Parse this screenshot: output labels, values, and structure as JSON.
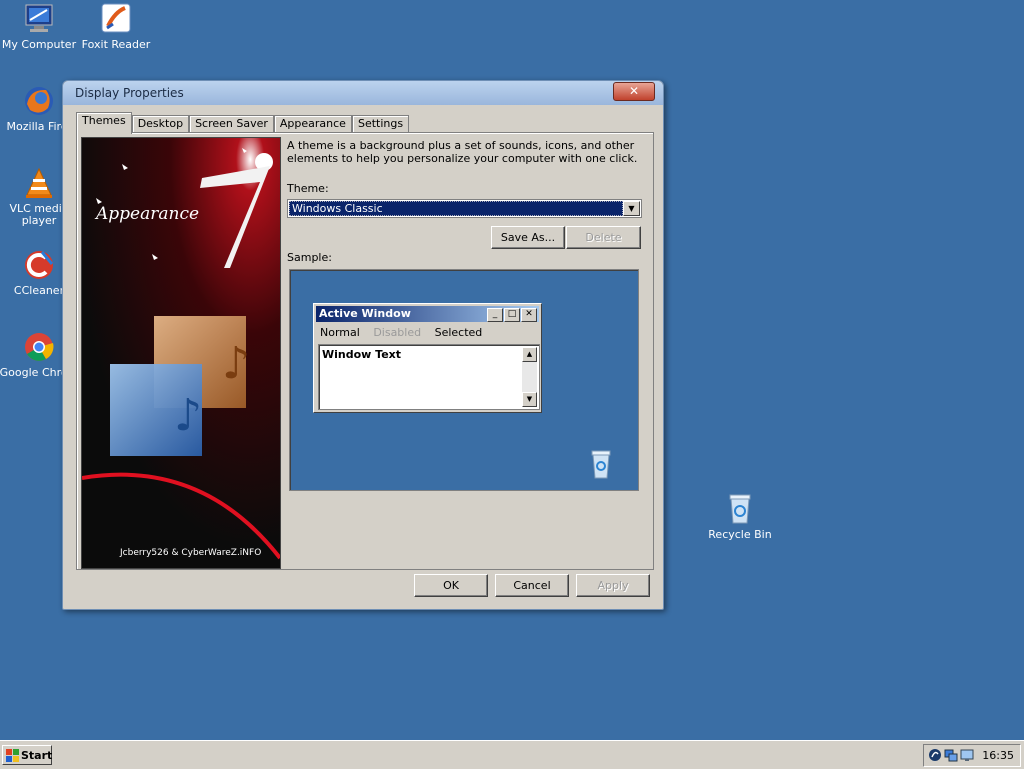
{
  "desktop": {
    "icons": [
      {
        "label": "My Computer",
        "icon": "my-computer-icon"
      },
      {
        "label": "Foxit Reader",
        "icon": "foxit-reader-icon"
      },
      {
        "label": "Mozilla Firef",
        "icon": "firefox-icon"
      },
      {
        "label": "VLC media player",
        "icon": "vlc-icon"
      },
      {
        "label": "CCleaner",
        "icon": "ccleaner-icon"
      },
      {
        "label": "Google Chrom",
        "icon": "chrome-icon"
      },
      {
        "label": "Recycle Bin",
        "icon": "recycle-bin-icon"
      }
    ]
  },
  "window": {
    "title": "Display Properties",
    "close_glyph": "✕",
    "tabs": [
      "Themes",
      "Desktop",
      "Screen Saver",
      "Appearance",
      "Settings"
    ],
    "active_tab": "Themes",
    "banner": {
      "title": "Appearance",
      "big_numeral": "7",
      "credit": "Jcberry526 & CyberWareZ.iNFO"
    },
    "description": "A theme is a background plus a set of sounds, icons, and other elements to help you personalize your computer with one click.",
    "theme_label": "Theme:",
    "theme_value": "Windows Classic",
    "save_as_label": "Save As...",
    "delete_label": "Delete",
    "sample_label": "Sample:",
    "sample": {
      "window_title": "Active Window",
      "menu_normal": "Normal",
      "menu_disabled": "Disabled",
      "menu_selected": "Selected",
      "window_text": "Window Text"
    },
    "ok_label": "OK",
    "cancel_label": "Cancel",
    "apply_label": "Apply"
  },
  "taskbar": {
    "start_label": "Start",
    "clock": "16:35"
  },
  "colors": {
    "desktop": "#3a6ea5",
    "selection": "#0a246a",
    "face": "#d4d0c8"
  }
}
